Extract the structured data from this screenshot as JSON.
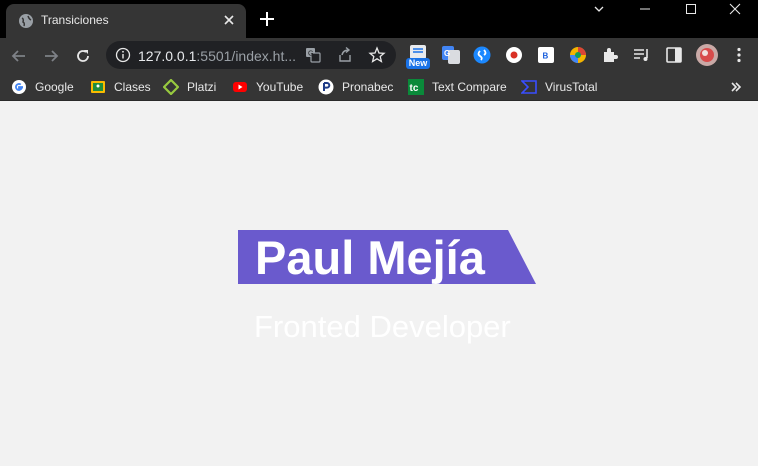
{
  "tab": {
    "title": "Transiciones"
  },
  "omnibox": {
    "host": "127.0.0.1",
    "path": ":5501/index.ht..."
  },
  "extensions": {
    "new_badge": "New"
  },
  "bookmarks": [
    {
      "label": "Google"
    },
    {
      "label": "Clases"
    },
    {
      "label": "Platzi"
    },
    {
      "label": "YouTube"
    },
    {
      "label": "Pronabec"
    },
    {
      "label": "Text Compare"
    },
    {
      "label": "VirusTotal"
    }
  ],
  "page": {
    "name": "Paul Mejía",
    "subtitle": "Fronted Developer"
  },
  "colors": {
    "banner": "#6a5acd",
    "page_background": "#f2f2f2"
  }
}
